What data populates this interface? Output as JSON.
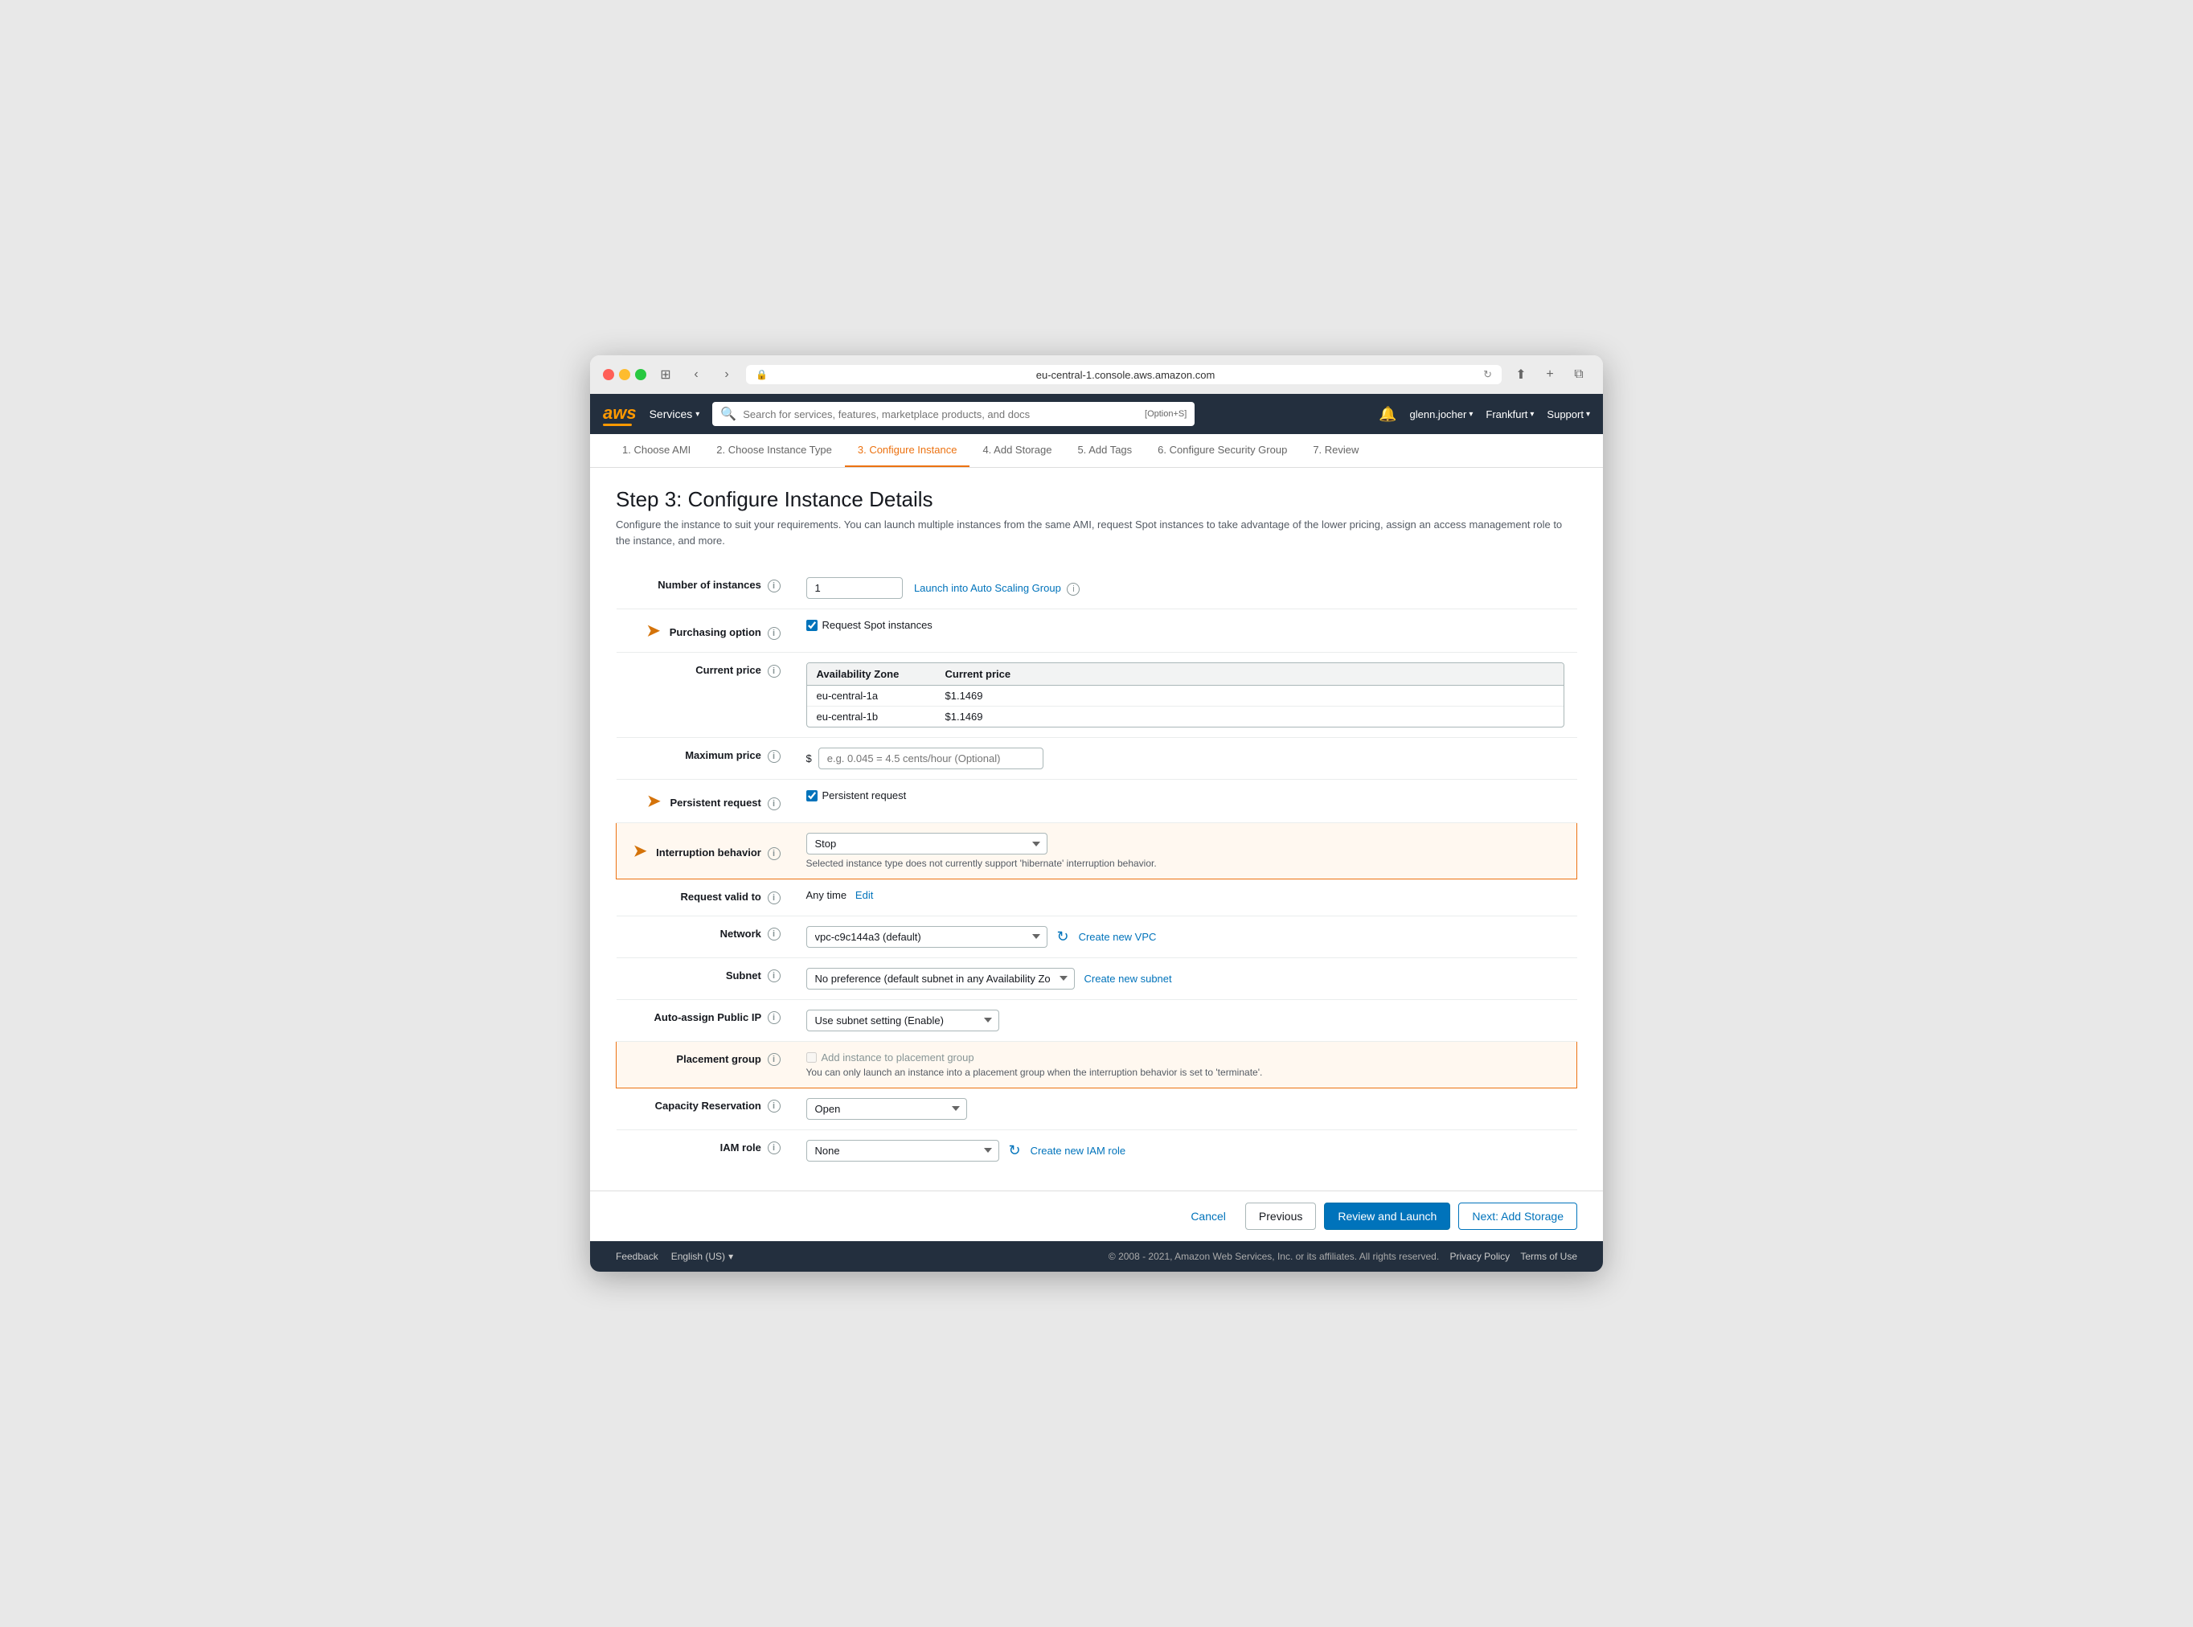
{
  "browser": {
    "url": "eu-central-1.console.aws.amazon.com",
    "refresh_icon": "↻"
  },
  "nav": {
    "logo": "aws",
    "services_label": "Services",
    "search_placeholder": "Search for services, features, marketplace products, and docs",
    "search_shortcut": "[Option+S]",
    "bell_icon": "🔔",
    "user": "glenn.jocher",
    "region": "Frankfurt",
    "support": "Support"
  },
  "wizard": {
    "steps": [
      {
        "label": "1. Choose AMI",
        "state": "inactive"
      },
      {
        "label": "2. Choose Instance Type",
        "state": "inactive"
      },
      {
        "label": "3. Configure Instance",
        "state": "active"
      },
      {
        "label": "4. Add Storage",
        "state": "inactive"
      },
      {
        "label": "5. Add Tags",
        "state": "inactive"
      },
      {
        "label": "6. Configure Security Group",
        "state": "inactive"
      },
      {
        "label": "7. Review",
        "state": "inactive"
      }
    ]
  },
  "page": {
    "title": "Step 3: Configure Instance Details",
    "description": "Configure the instance to suit your requirements. You can launch multiple instances from the same AMI, request Spot instances to take advantage of the lower pricing, assign an access management role to the instance, and more."
  },
  "form": {
    "number_of_instances_label": "Number of instances",
    "number_of_instances_value": "1",
    "launch_auto_scaling_label": "Launch into Auto Scaling Group",
    "purchasing_option_label": "Purchasing option",
    "request_spot_label": "Request Spot instances",
    "current_price_label": "Current price",
    "price_table_headers": [
      "Availability Zone",
      "Current price"
    ],
    "price_rows": [
      {
        "zone": "eu-central-1a",
        "price": "$1.1469"
      },
      {
        "zone": "eu-central-1b",
        "price": "$1.1469"
      }
    ],
    "max_price_label": "Maximum price",
    "max_price_placeholder": "e.g. 0.045 = 4.5 cents/hour (Optional)",
    "max_price_prefix": "$",
    "persistent_request_label": "Persistent request",
    "persistent_request_check_label": "Persistent request",
    "interruption_behavior_label": "Interruption behavior",
    "interruption_behavior_value": "Stop",
    "interruption_warning": "Selected instance type does not currently support 'hibernate' interruption behavior.",
    "request_valid_to_label": "Request valid to",
    "request_valid_to_value": "Any time",
    "edit_label": "Edit",
    "network_label": "Network",
    "network_value": "vpc-c9c144a3 (default)",
    "create_new_vpc_label": "Create new VPC",
    "subnet_label": "Subnet",
    "subnet_value": "No preference (default subnet in any Availability Zo",
    "create_new_subnet_label": "Create new subnet",
    "auto_assign_ip_label": "Auto-assign Public IP",
    "auto_assign_ip_value": "Use subnet setting (Enable)",
    "placement_group_label": "Placement group",
    "placement_group_checkbox_label": "Add instance to placement group",
    "placement_group_note": "You can only launch an instance into a placement group when the interruption behavior is set to 'terminate'.",
    "capacity_reservation_label": "Capacity Reservation",
    "capacity_reservation_value": "Open",
    "iam_role_label": "IAM role"
  },
  "actions": {
    "cancel_label": "Cancel",
    "previous_label": "Previous",
    "review_and_launch_label": "Review and Launch",
    "next_label": "Next: Add Storage"
  },
  "footer": {
    "feedback_label": "Feedback",
    "language_label": "English (US)",
    "copyright": "© 2008 - 2021, Amazon Web Services, Inc. or its affiliates. All rights reserved.",
    "privacy_label": "Privacy Policy",
    "terms_label": "Terms of Use"
  }
}
